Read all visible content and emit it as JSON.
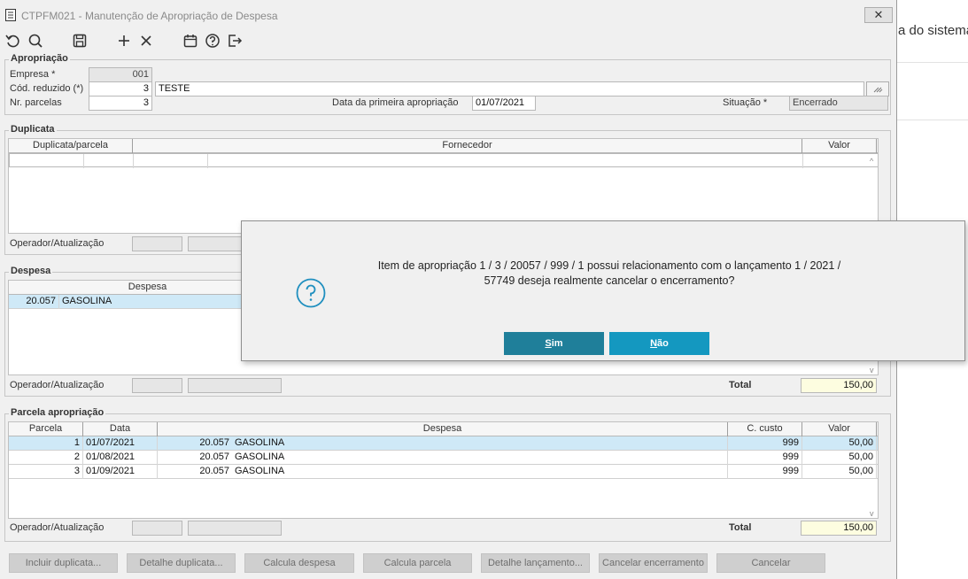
{
  "background": {
    "text": "a do sistema"
  },
  "window": {
    "title": "CTPFM021 - Manutenção de Apropriação de Despesa",
    "close_glyph": "✕"
  },
  "toolbar": {
    "icons": [
      "undo-icon",
      "search-icon",
      "save-icon",
      "add-icon",
      "delete-icon",
      "calendar-icon",
      "help-icon",
      "exit-icon"
    ]
  },
  "apropriacao": {
    "title": "Apropriação",
    "empresa_label": "Empresa *",
    "empresa_value": "001",
    "cod_label": "Cód. reduzido (*)",
    "cod_value": "3",
    "cod_desc": "TESTE",
    "parcelas_label": "Nr. parcelas",
    "parcelas_value": "3",
    "data_label": "Data da primeira apropriação",
    "data_value": "01/07/2021",
    "situacao_label": "Situação *",
    "situacao_value": "Encerrado"
  },
  "duplicata": {
    "title": "Duplicata",
    "columns": [
      "Duplicata/parcela",
      "Fornecedor",
      "Valor"
    ],
    "operador_label": "Operador/Atualização"
  },
  "despesa": {
    "title": "Despesa",
    "column": "Despesa",
    "rows": [
      {
        "code": "20.057",
        "name": "GASOLINA"
      }
    ],
    "operador_label": "Operador/Atualização",
    "total_label": "Total",
    "total_value": "150,00"
  },
  "parcela": {
    "title": "Parcela apropriação",
    "columns": [
      "Parcela",
      "Data",
      "Despesa",
      "C. custo",
      "Valor"
    ],
    "rows": [
      {
        "parcela": "1",
        "data": "01/07/2021",
        "code": "20.057",
        "name": "GASOLINA",
        "custo": "999",
        "valor": "50,00"
      },
      {
        "parcela": "2",
        "data": "01/08/2021",
        "code": "20.057",
        "name": "GASOLINA",
        "custo": "999",
        "valor": "50,00"
      },
      {
        "parcela": "3",
        "data": "01/09/2021",
        "code": "20.057",
        "name": "GASOLINA",
        "custo": "999",
        "valor": "50,00"
      }
    ],
    "operador_label": "Operador/Atualização",
    "total_label": "Total",
    "total_value": "150,00"
  },
  "footer_buttons": [
    "Incluir duplicata...",
    "Detalhe duplicata...",
    "Calcula despesa",
    "Calcula parcela",
    "Detalhe lançamento...",
    "Cancelar encerramento",
    "Cancelar"
  ],
  "dialog": {
    "line1": "Item de apropriação 1 / 3 / 20057 / 999 / 1 possui relacionamento com o lançamento 1 / 2021 /",
    "line2": "57749 deseja realmente cancelar o encerramento?",
    "sim_first": "S",
    "sim_rest": "im",
    "nao_first": "N",
    "nao_rest": "ão",
    "icon": "question-icon",
    "icon_color": "#1f8fbf"
  }
}
